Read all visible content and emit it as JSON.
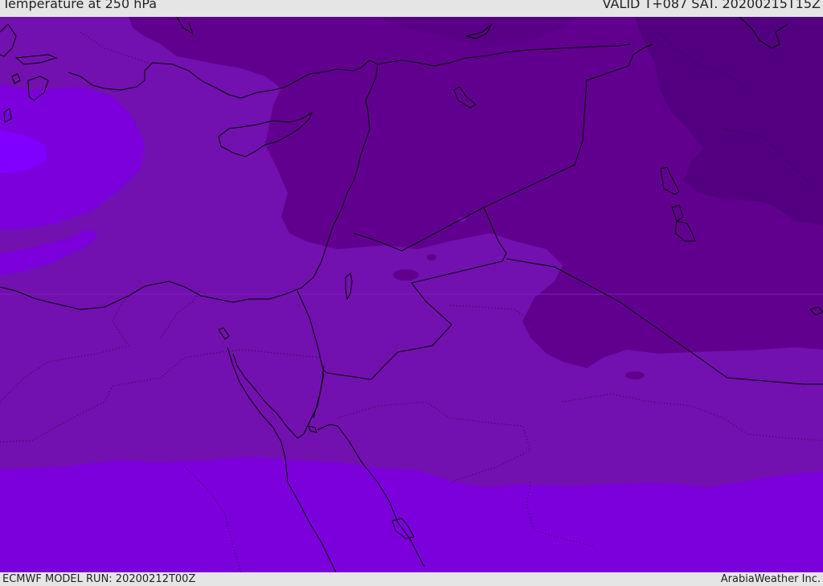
{
  "header": {
    "title": "Temperature at 250 hPa",
    "valid": "VALID T+087 SAT. 20200215T15Z"
  },
  "footer": {
    "model_run": "ECMWF MODEL RUN: 20200212T00Z",
    "credit": "ArabiaWeather Inc."
  },
  "colors": {
    "background": "#e5e5e5",
    "band_coldest": "#52007f",
    "band_cold": "#61008f",
    "band_mid": "#7211af",
    "band_warm": "#7b00dc",
    "band_warmest": "#7f00ff",
    "coastline": "#000000",
    "borders": "#000000"
  }
}
